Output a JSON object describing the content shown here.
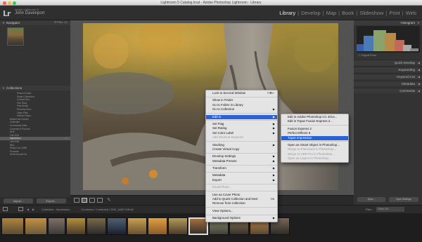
{
  "window": {
    "title": "Lightroom 5 Catalog.lrcat - Adobe Photoshop Lightroom - Library"
  },
  "header": {
    "logo": "Lr",
    "catalog": "Adobe Lightroom 5",
    "user": "John Davenport",
    "modules": [
      "Library",
      "Develop",
      "Map",
      "Book",
      "Slideshow",
      "Print",
      "Web"
    ],
    "active_module": "Library"
  },
  "left_panel": {
    "navigator_title": "Navigator",
    "navigator_zoom": "FIT  FILL  1:1",
    "collections_title": "Collections",
    "collections": [
      {
        "label": "Photo's Folder",
        "count": "",
        "sub": true
      },
      {
        "label": "Smart Collections",
        "count": "",
        "sub": true
      },
      {
        "label": "Colored Red",
        "count": "",
        "sub": true
      },
      {
        "label": "Five Stars",
        "count": "",
        "sub": true
      },
      {
        "label": "Past Month",
        "count": "",
        "sub": true
      },
      {
        "label": "Recently Mod...",
        "count": "",
        "sub": true
      },
      {
        "label": "Video Files",
        "count": "",
        "sub": true
      },
      {
        "label": "Without Keyw...",
        "count": "",
        "sub": true
      },
      {
        "label": "Behind the Scenes",
        "count": "",
        "sub": false
      },
      {
        "label": "Collection",
        "count": "",
        "sub": false
      },
      {
        "label": "Community Edits",
        "count": "",
        "sub": false
      },
      {
        "label": "Currently in Process",
        "count": "",
        "sub": false
      },
      {
        "label": "DHS",
        "count": "",
        "sub": false
      },
      {
        "label": "Fall 2014",
        "count": "",
        "sub": false
      },
      {
        "label": "Impression",
        "count": "13",
        "sub": false,
        "selected": true
      },
      {
        "label": "Let's Edit",
        "count": "",
        "sub": false
      },
      {
        "label": "Misc",
        "count": "",
        "sub": false
      },
      {
        "label": "Photos for LDME",
        "count": "",
        "sub": false
      },
      {
        "label": "Products",
        "count": "",
        "sub": false
      },
      {
        "label": "World Around Us",
        "count": "",
        "sub": false
      }
    ],
    "import_label": "Import...",
    "export_label": "Export..."
  },
  "right_panel": {
    "histogram_title": "Histogram",
    "original_photo": "Original Photo",
    "quick_develop": "Quick Develop",
    "keywording": "Keywording",
    "keyword_list": "Keyword List",
    "metadata": "Metadata",
    "comments": "Comments",
    "sync_label": "Sync...",
    "sync_settings": "Sync Settings"
  },
  "context_menu": {
    "items": [
      {
        "label": "Lock to Second Window",
        "shortcut": "⇧⌘↩",
        "type": "item"
      },
      {
        "type": "sep"
      },
      {
        "label": "Show in Finder",
        "type": "item"
      },
      {
        "label": "Go to Folder in Library",
        "type": "item"
      },
      {
        "label": "Go to Collection",
        "type": "item",
        "submenu": true
      },
      {
        "type": "sep"
      },
      {
        "label": "Edit In",
        "type": "item",
        "submenu": true,
        "highlight": true
      },
      {
        "type": "sep"
      },
      {
        "label": "Set Flag",
        "type": "item",
        "submenu": true
      },
      {
        "label": "Set Rating",
        "type": "item",
        "submenu": true
      },
      {
        "label": "Set Color Label",
        "type": "item",
        "submenu": true
      },
      {
        "label": "Add Shortcut Keyword",
        "type": "item",
        "disabled": true
      },
      {
        "type": "sep"
      },
      {
        "label": "Stacking",
        "type": "item",
        "submenu": true
      },
      {
        "label": "Create Virtual Copy",
        "type": "item"
      },
      {
        "type": "sep"
      },
      {
        "label": "Develop Settings",
        "type": "item",
        "submenu": true
      },
      {
        "label": "Metadata Presets",
        "type": "item",
        "submenu": true
      },
      {
        "type": "sep"
      },
      {
        "label": "Transform",
        "type": "item",
        "submenu": true
      },
      {
        "type": "sep"
      },
      {
        "label": "Metadata",
        "type": "item",
        "submenu": true
      },
      {
        "label": "Export",
        "type": "item",
        "submenu": true
      },
      {
        "type": "sep"
      },
      {
        "label": "Email Photo...",
        "type": "item",
        "disabled": true
      },
      {
        "type": "sep"
      },
      {
        "label": "Use as Cover Photo",
        "type": "item"
      },
      {
        "label": "Add to Quick Collection and Next",
        "shortcut": "⇧B",
        "type": "item"
      },
      {
        "label": "Remove from Collection",
        "type": "item"
      },
      {
        "type": "sep"
      },
      {
        "label": "View Options...",
        "type": "item"
      },
      {
        "type": "sep"
      },
      {
        "label": "Background Options",
        "type": "item",
        "submenu": true
      }
    ]
  },
  "submenu": {
    "items": [
      {
        "label": "Edit in Adobe Photoshop CC 2014...",
        "type": "item"
      },
      {
        "label": "Edit in Topaz Fusion Express 2...",
        "type": "item"
      },
      {
        "type": "sep"
      },
      {
        "label": "Fusion Express 2",
        "type": "item"
      },
      {
        "label": "Perfect Effects 8",
        "type": "item"
      },
      {
        "label": "Topaz Impression",
        "type": "item",
        "highlight": true
      },
      {
        "type": "sep"
      },
      {
        "label": "Open as Smart Object in Photoshop...",
        "type": "item"
      },
      {
        "label": "Merge to Panorama in Photoshop...",
        "type": "item",
        "disabled": true
      },
      {
        "label": "Merge to HDR Pro in Photoshop...",
        "type": "item",
        "disabled": true
      },
      {
        "label": "Open as Layers in Photoshop...",
        "type": "item",
        "disabled": true
      }
    ]
  },
  "filmstrip_bar": {
    "collection": "Collection : Impression",
    "photos": "13 photos / 1 selected / DSC_8367-Edit.tif",
    "filter_label": "Filter :",
    "filter_value": "Filters Off"
  },
  "colors": {
    "highlight": "#2a62d8",
    "panel": "#333333",
    "background": "#525252"
  }
}
